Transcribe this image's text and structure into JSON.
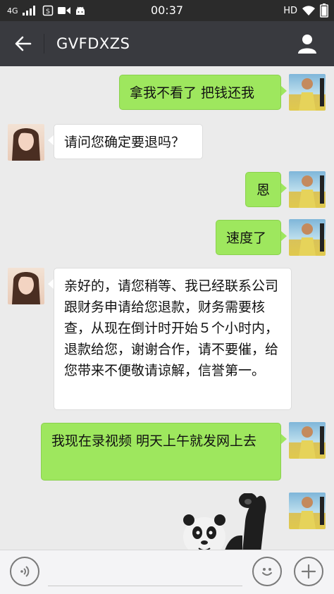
{
  "status_bar": {
    "network": "4G",
    "time": "00:37",
    "hd": "HD"
  },
  "header": {
    "title": "GVFDXZS"
  },
  "messages": [
    {
      "side": "me",
      "text": "拿我不看了  把钱还我"
    },
    {
      "side": "her",
      "text": "请问您确定要退吗？"
    },
    {
      "side": "me",
      "text": "恩"
    },
    {
      "side": "me",
      "text": "速度了"
    },
    {
      "side": "her",
      "text": "亲好的，请您稍等、我已经联系公司跟财务申请给您退款，财务需要核查，从现在倒计时开始５个小时内，退款给您，谢谢合作，请不要催，给您带来不便敬请谅解，信誉第一。"
    },
    {
      "side": "me",
      "text": "我现在录视频  明天上午就发网上去"
    },
    {
      "side": "me",
      "type": "sticker",
      "sticker": "panda-waving-sticker"
    }
  ],
  "icons": {
    "back": "arrow-left-icon",
    "profile": "person-icon",
    "voice": "voice-icon",
    "emoji": "emoji-icon",
    "more": "plus-icon"
  },
  "colors": {
    "title_bar": "#393a3f",
    "status_bar": "#2b2b2b",
    "chat_bg": "#ebebeb",
    "my_bubble": "#9ee75e",
    "their_bubble": "#ffffff"
  }
}
